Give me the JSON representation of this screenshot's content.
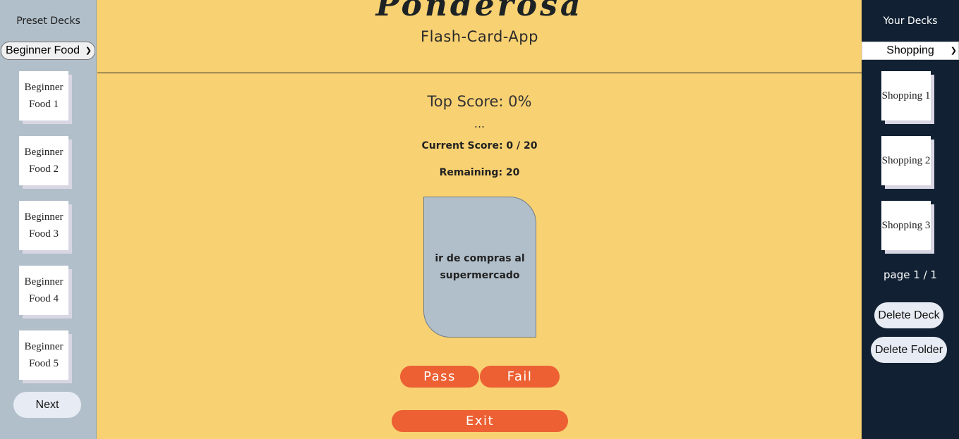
{
  "left_sidebar": {
    "title": "Preset Decks",
    "selected_deck": "Beginner Food",
    "decks": [
      "Beginner Food 1",
      "Beginner Food 2",
      "Beginner Food 3",
      "Beginner Food 4",
      "Beginner Food 5"
    ],
    "next_label": "Next"
  },
  "right_sidebar": {
    "title": "Your Decks",
    "selected_folder": "Shopping",
    "decks": [
      "Shopping 1",
      "Shopping 2",
      "Shopping 3"
    ],
    "page_indicator": "page 1 / 1",
    "delete_deck_label": "Delete Deck",
    "delete_folder_label": "Delete Folder"
  },
  "header": {
    "brand": "Ponderosa",
    "subtitle": "Flash-Card-App"
  },
  "quiz": {
    "top_score": "Top Score: 0%",
    "dots": "...",
    "current_score": "Current Score: 0 / 20",
    "remaining": "Remaining: 20",
    "card_text": "ir de compras al supermercado",
    "pass_label": "Pass",
    "fail_label": "Fail",
    "exit_label": "Exit"
  },
  "colors": {
    "background": "#f8d172",
    "left_sidebar": "#b1bfca",
    "right_sidebar": "#112133",
    "accent": "#ec6033",
    "card": "#b1bfca"
  }
}
